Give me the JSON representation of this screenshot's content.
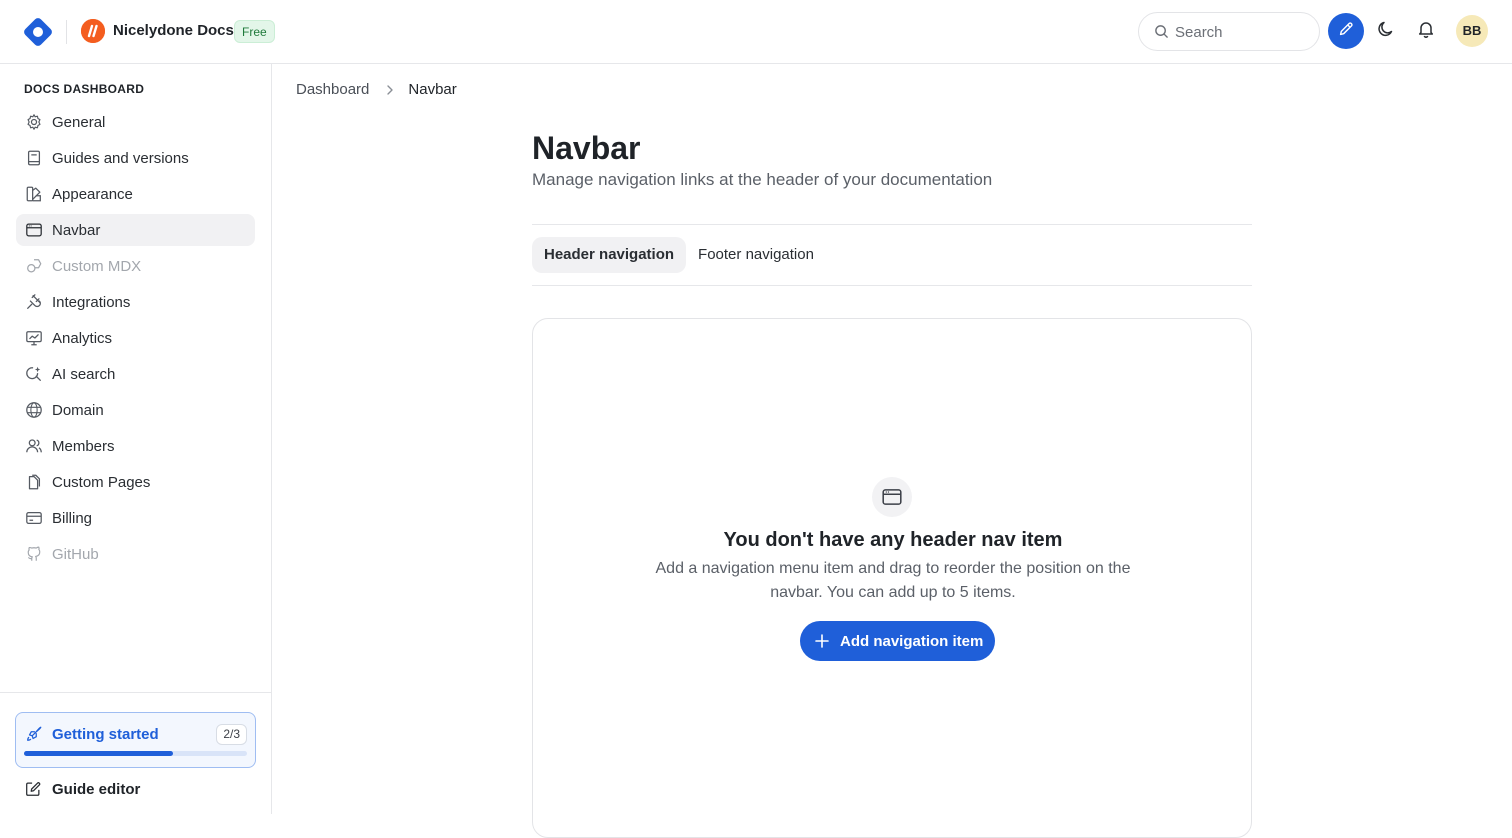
{
  "header": {
    "logo_icon": "diamond-logo-icon",
    "project_name": "Nicelydone Docs",
    "plan_badge": "Free",
    "search_placeholder": "Search",
    "avatar_initials": "BB",
    "accent_color": "#1f5fd9"
  },
  "sidebar": {
    "heading": "DOCS DASHBOARD",
    "items": [
      {
        "label": "General",
        "icon": "gear-icon"
      },
      {
        "label": "Guides and versions",
        "icon": "book-icon"
      },
      {
        "label": "Appearance",
        "icon": "palette-icon"
      },
      {
        "label": "Navbar",
        "icon": "browser-window-icon",
        "active": true
      },
      {
        "label": "Custom MDX",
        "icon": "shapes-icon",
        "disabled": true
      },
      {
        "label": "Integrations",
        "icon": "plug-icon"
      },
      {
        "label": "Analytics",
        "icon": "chart-monitor-icon"
      },
      {
        "label": "AI search",
        "icon": "ai-search-icon"
      },
      {
        "label": "Domain",
        "icon": "globe-icon"
      },
      {
        "label": "Members",
        "icon": "users-icon"
      },
      {
        "label": "Custom Pages",
        "icon": "pages-icon"
      },
      {
        "label": "Billing",
        "icon": "credit-card-icon"
      },
      {
        "label": "GitHub",
        "icon": "github-icon",
        "disabled": true
      }
    ],
    "getting_started": {
      "label": "Getting started",
      "count": "2/3",
      "progress": 0.667
    },
    "guide_editor": "Guide editor"
  },
  "breadcrumb": {
    "parent": "Dashboard",
    "current": "Navbar"
  },
  "main": {
    "title": "Navbar",
    "subtitle": "Manage navigation links at the header of your documentation",
    "tabs": [
      {
        "label": "Header navigation",
        "active": true
      },
      {
        "label": "Footer navigation",
        "active": false
      }
    ],
    "empty_state": {
      "title": "You don't have any header nav item",
      "description": "Add a navigation menu item and drag to reorder the position on the navbar. You can add up to 5 items.",
      "button_label": "Add navigation item"
    }
  }
}
